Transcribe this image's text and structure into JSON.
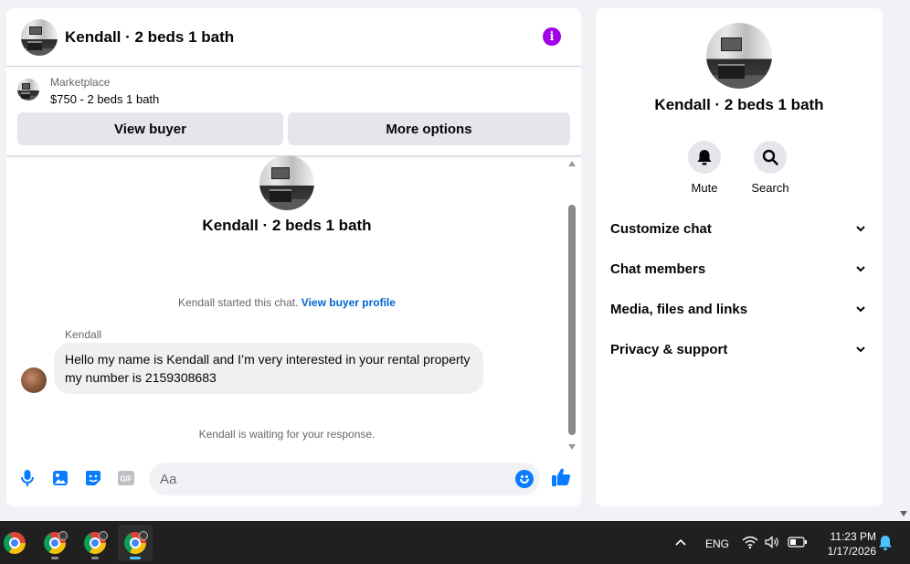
{
  "chat": {
    "title": "Kendall · 2 beds 1 bath",
    "marketplace_label": "Marketplace",
    "listing": "$750 - 2 beds 1 bath",
    "view_buyer": "View buyer",
    "more_options": "More options",
    "center_title": "Kendall · 2 beds 1 bath",
    "started_text": "Kendall started this chat.",
    "view_buyer_profile": "View buyer profile",
    "sender_name": "Kendall",
    "message": "Hello my name is Kendall and I’m very interested in your rental property my number is 2159308683",
    "waiting_text": "Kendall is waiting for your response.",
    "input_placeholder": "Aa"
  },
  "info": {
    "title": "Kendall · 2 beds 1 bath",
    "mute_label": "Mute",
    "search_label": "Search",
    "sections": [
      {
        "label": "Customize chat"
      },
      {
        "label": "Chat members"
      },
      {
        "label": "Media, files and links"
      },
      {
        "label": "Privacy & support"
      }
    ]
  },
  "taskbar": {
    "lang": "ENG",
    "time": "11:23 PM",
    "date": "1/17/2026"
  },
  "colors": {
    "accent_blue": "#0a7cff",
    "info_purple": "#a200e6",
    "taskbar_bg": "#202020"
  }
}
